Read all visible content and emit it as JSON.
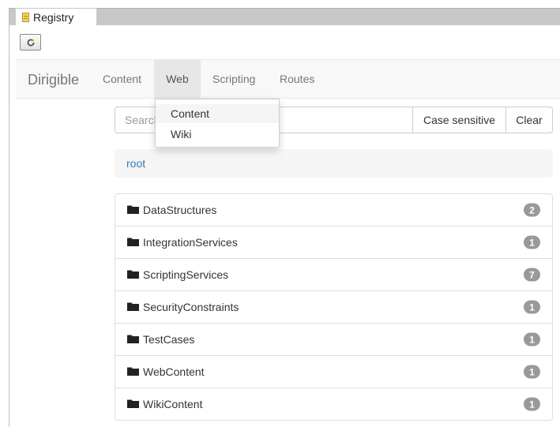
{
  "window_tab": {
    "title": "Registry",
    "icon": "notepad-icon"
  },
  "toolbar": {
    "refresh_icon": "refresh-icon"
  },
  "navbar": {
    "brand": "Dirigible",
    "items": [
      {
        "label": "Content"
      },
      {
        "label": "Web",
        "active": true
      },
      {
        "label": "Scripting"
      },
      {
        "label": "Routes"
      }
    ]
  },
  "dropdown": {
    "items": [
      {
        "label": "Content",
        "highlighted": true
      },
      {
        "label": "Wiki"
      }
    ]
  },
  "search": {
    "placeholder": "Search",
    "value": "",
    "case_sensitive_label": "Case sensitive",
    "clear_label": "Clear"
  },
  "breadcrumb": {
    "root_label": "root"
  },
  "folders": [
    {
      "name": "DataStructures",
      "count": "2"
    },
    {
      "name": "IntegrationServices",
      "count": "1"
    },
    {
      "name": "ScriptingServices",
      "count": "7"
    },
    {
      "name": "SecurityConstraints",
      "count": "1"
    },
    {
      "name": "TestCases",
      "count": "1"
    },
    {
      "name": "WebContent",
      "count": "1"
    },
    {
      "name": "WikiContent",
      "count": "1"
    }
  ],
  "colors": {
    "link": "#337ab7",
    "badge": "#999999",
    "navbar_bg": "#f8f8f8",
    "nav_active_bg": "#e7e7e7"
  },
  "icons": {
    "folder": "folder-icon"
  }
}
